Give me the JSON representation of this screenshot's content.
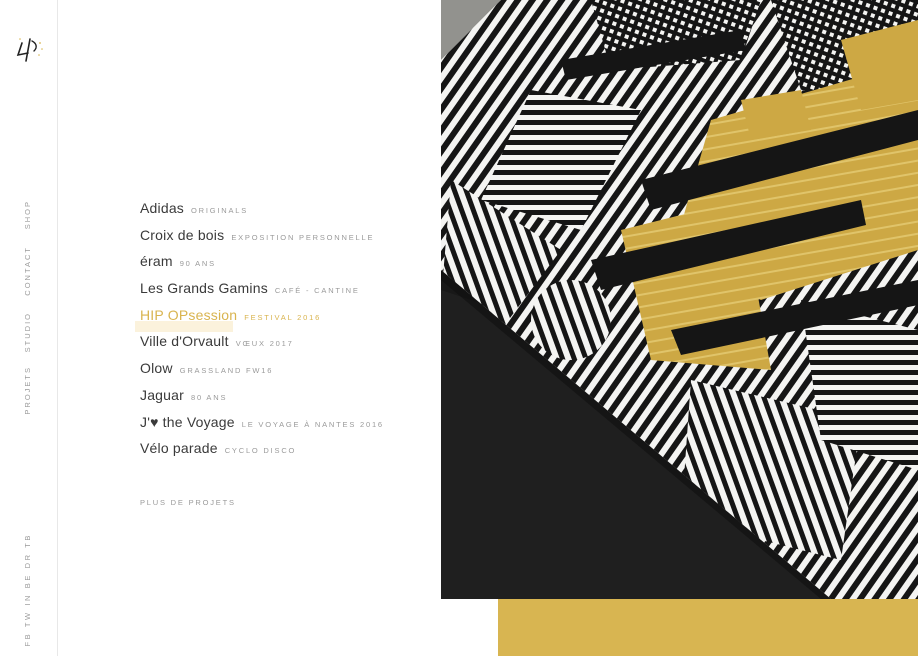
{
  "sidebar": {
    "nav": [
      "Shop",
      "Contact",
      "Studio",
      "Projets"
    ],
    "social": "FB TW IN BE DR TB"
  },
  "projects": [
    {
      "name": "Adidas",
      "tag": "Originals"
    },
    {
      "name": "Croix de bois",
      "tag": "Exposition personnelle"
    },
    {
      "name": "éram",
      "tag": "90 ans"
    },
    {
      "name": "Les Grands Gamins",
      "tag": "Café - cantine"
    },
    {
      "name": "HIP OPsession",
      "tag": "Festival 2016"
    },
    {
      "name": "Ville d'Orvault",
      "tag": "Vœux 2017"
    },
    {
      "name": "Olow",
      "tag": "Grassland FW16"
    },
    {
      "name": "Jaguar",
      "tag": "80 ans"
    },
    {
      "name": "J'♥ the Voyage",
      "tag": "Le voyage à Nantes 2016"
    },
    {
      "name": "Vélo parade",
      "tag": "Cyclo disco"
    }
  ],
  "active_project": "HIP OPsession",
  "more_label": "Plus de projets",
  "colors": {
    "accent": "#d8b551",
    "accent_text": "#d9b44f",
    "text": "#3a3a3a",
    "muted": "#9a9a9a"
  },
  "icons": {
    "logo": "brand-logo-icon"
  }
}
